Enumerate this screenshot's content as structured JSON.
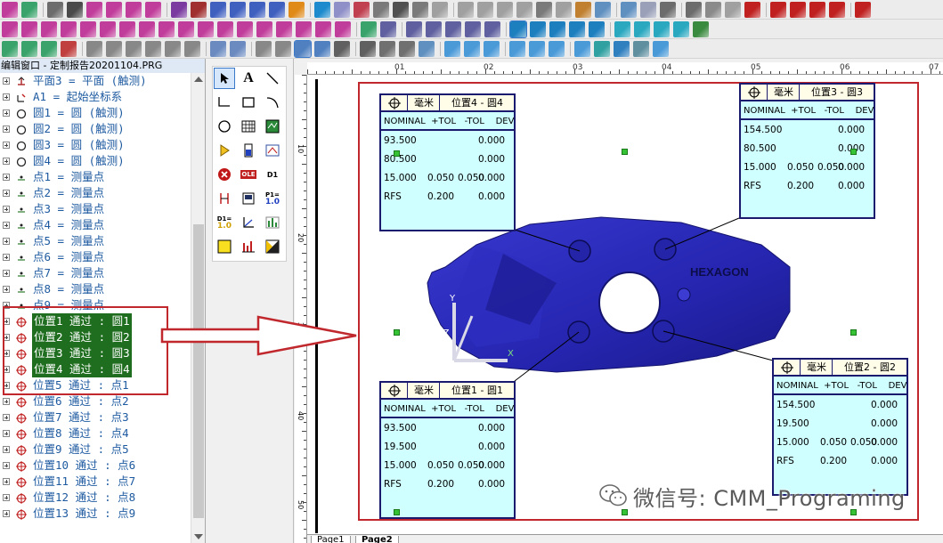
{
  "window": {
    "tree_title": "编辑窗口 - 定制报告20201104.PRG"
  },
  "tree": {
    "items": [
      {
        "label": "平面3 = 平面 (触测)",
        "icon": "plane-icon",
        "highlight": false
      },
      {
        "label": "A1 = 起始坐标系",
        "icon": "alignment-icon",
        "highlight": false
      },
      {
        "label": "圆1 = 圆 (触测)",
        "icon": "circle-feature-icon",
        "highlight": false
      },
      {
        "label": "圆2 = 圆 (触测)",
        "icon": "circle-feature-icon",
        "highlight": false
      },
      {
        "label": "圆3 = 圆 (触测)",
        "icon": "circle-feature-icon",
        "highlight": false
      },
      {
        "label": "圆4 = 圆 (触测)",
        "icon": "circle-feature-icon",
        "highlight": false
      },
      {
        "label": "点1 = 测量点",
        "icon": "point-icon",
        "highlight": false
      },
      {
        "label": "点2 = 测量点",
        "icon": "point-icon",
        "highlight": false
      },
      {
        "label": "点3 = 测量点",
        "icon": "point-icon",
        "highlight": false
      },
      {
        "label": "点4 = 测量点",
        "icon": "point-icon",
        "highlight": false
      },
      {
        "label": "点5 = 测量点",
        "icon": "point-icon",
        "highlight": false
      },
      {
        "label": "点6 = 测量点",
        "icon": "point-icon",
        "highlight": false
      },
      {
        "label": "点7 = 测量点",
        "icon": "point-icon",
        "highlight": false
      },
      {
        "label": "点8 = 测量点",
        "icon": "point-icon",
        "highlight": false
      },
      {
        "label": "点9 = 测量点",
        "icon": "point-icon",
        "highlight": false
      },
      {
        "label": "位置1 通过 : 圆1",
        "icon": "position-icon",
        "highlight": true
      },
      {
        "label": "位置2 通过 : 圆2",
        "icon": "position-icon",
        "highlight": true
      },
      {
        "label": "位置3 通过 : 圆3",
        "icon": "position-icon",
        "highlight": true
      },
      {
        "label": "位置4 通过 : 圆4",
        "icon": "position-icon",
        "highlight": true
      },
      {
        "label": "位置5 通过 : 点1",
        "icon": "position-icon",
        "highlight": false
      },
      {
        "label": "位置6 通过 : 点2",
        "icon": "position-icon",
        "highlight": false
      },
      {
        "label": "位置7 通过 : 点3",
        "icon": "position-icon",
        "highlight": false
      },
      {
        "label": "位置8 通过 : 点4",
        "icon": "position-icon",
        "highlight": false
      },
      {
        "label": "位置9 通过 : 点5",
        "icon": "position-icon",
        "highlight": false
      },
      {
        "label": "位置10 通过 : 点6",
        "icon": "position-icon",
        "highlight": false
      },
      {
        "label": "位置11 通过 : 点7",
        "icon": "position-icon",
        "highlight": false
      },
      {
        "label": "位置12 通过 : 点8",
        "icon": "position-icon",
        "highlight": false
      },
      {
        "label": "位置13 通过 : 点9",
        "icon": "position-icon",
        "highlight": false
      }
    ]
  },
  "palette": {
    "tools": [
      "select-arrow-icon",
      "text-tool-icon",
      "line-tool-icon",
      "polyline-tool-icon",
      "rectangle-tool-icon",
      "arc-tool-icon",
      "ellipse-tool-icon",
      "grid-tool-icon",
      "analysis-window-icon",
      "play-tool-icon",
      "gauge-tool-icon",
      "cad-view-icon",
      "stop-tool-icon",
      "ole-object-icon",
      "dimension-info-icon",
      "label-tool-icon",
      "text-box-icon",
      "label-template-icon",
      "dimension-label-icon",
      "axis-tool-icon",
      "histogram-tool-icon",
      "color-box-icon",
      "bar-chart-icon",
      "image-tool-icon"
    ],
    "text_labels": {
      "text_tool": "A",
      "ole": "OLE",
      "d1": "D1",
      "p1": "P1=",
      "p1_val": "1.0",
      "d1b": "D1=",
      "d1b_val": "1.0"
    }
  },
  "ruler": {
    "h_labels": [
      "01",
      "02",
      "03",
      "04",
      "05",
      "06",
      "07"
    ],
    "v_labels": [
      "10",
      "20",
      "30",
      "40",
      "50"
    ]
  },
  "part": {
    "brand_text": "HEXAGON",
    "axis_x": "X",
    "axis_y": "Y",
    "axis_z": "Z"
  },
  "callouts": [
    {
      "unit": "毫米",
      "name": "位置4 - 圆4",
      "columns": "NOMINAL  +TOL   -TOL    DEV",
      "rows": [
        {
          "nominal": "93.500",
          "plus": "",
          "minus": "",
          "dev": "0.000"
        },
        {
          "nominal": "80.500",
          "plus": "",
          "minus": "",
          "dev": "0.000"
        },
        {
          "nominal": "15.000",
          "plus": "0.050",
          "minus": "0.050",
          "dev": "0.000"
        }
      ],
      "rfs": {
        "label": "RFS",
        "tol": "0.200",
        "dev": "0.000"
      }
    },
    {
      "unit": "毫米",
      "name": "位置3 - 圆3",
      "columns": "NOMINAL  +TOL   -TOL    DEV",
      "rows": [
        {
          "nominal": "154.500",
          "plus": "",
          "minus": "",
          "dev": "0.000"
        },
        {
          "nominal": "80.500",
          "plus": "",
          "minus": "",
          "dev": "0.000"
        },
        {
          "nominal": "15.000",
          "plus": "0.050",
          "minus": "0.050",
          "dev": "0.000"
        }
      ],
      "rfs": {
        "label": "RFS",
        "tol": "0.200",
        "dev": "0.000"
      }
    },
    {
      "unit": "毫米",
      "name": "位置1 - 圆1",
      "columns": "NOMINAL  +TOL   -TOL    DEV",
      "rows": [
        {
          "nominal": "93.500",
          "plus": "",
          "minus": "",
          "dev": "0.000"
        },
        {
          "nominal": "19.500",
          "plus": "",
          "minus": "",
          "dev": "0.000"
        },
        {
          "nominal": "15.000",
          "plus": "0.050",
          "minus": "0.050",
          "dev": "0.000"
        }
      ],
      "rfs": {
        "label": "RFS",
        "tol": "0.200",
        "dev": "0.000"
      }
    },
    {
      "unit": "毫米",
      "name": "位置2 - 圆2",
      "columns": "NOMINAL  +TOL   -TOL    DEV",
      "rows": [
        {
          "nominal": "154.500",
          "plus": "",
          "minus": "",
          "dev": "0.000"
        },
        {
          "nominal": "19.500",
          "plus": "",
          "minus": "",
          "dev": "0.000"
        },
        {
          "nominal": "15.000",
          "plus": "0.050",
          "minus": "0.050",
          "dev": "0.000"
        }
      ],
      "rfs": {
        "label": "RFS",
        "tol": "0.200",
        "dev": "0.000"
      }
    }
  ],
  "tabs": [
    "Page1",
    "Page2"
  ],
  "watermark": "微信号: CMM_Programing",
  "colors": {
    "highlight_bg": "#1f6e1f",
    "annotation_red": "#c0282d",
    "callout_bg": "#cfffff",
    "callout_border": "#1a1a6e",
    "part_blue": "#2a2ab8",
    "marker_green": "#35c235",
    "tree_text": "#1e5aa0"
  }
}
